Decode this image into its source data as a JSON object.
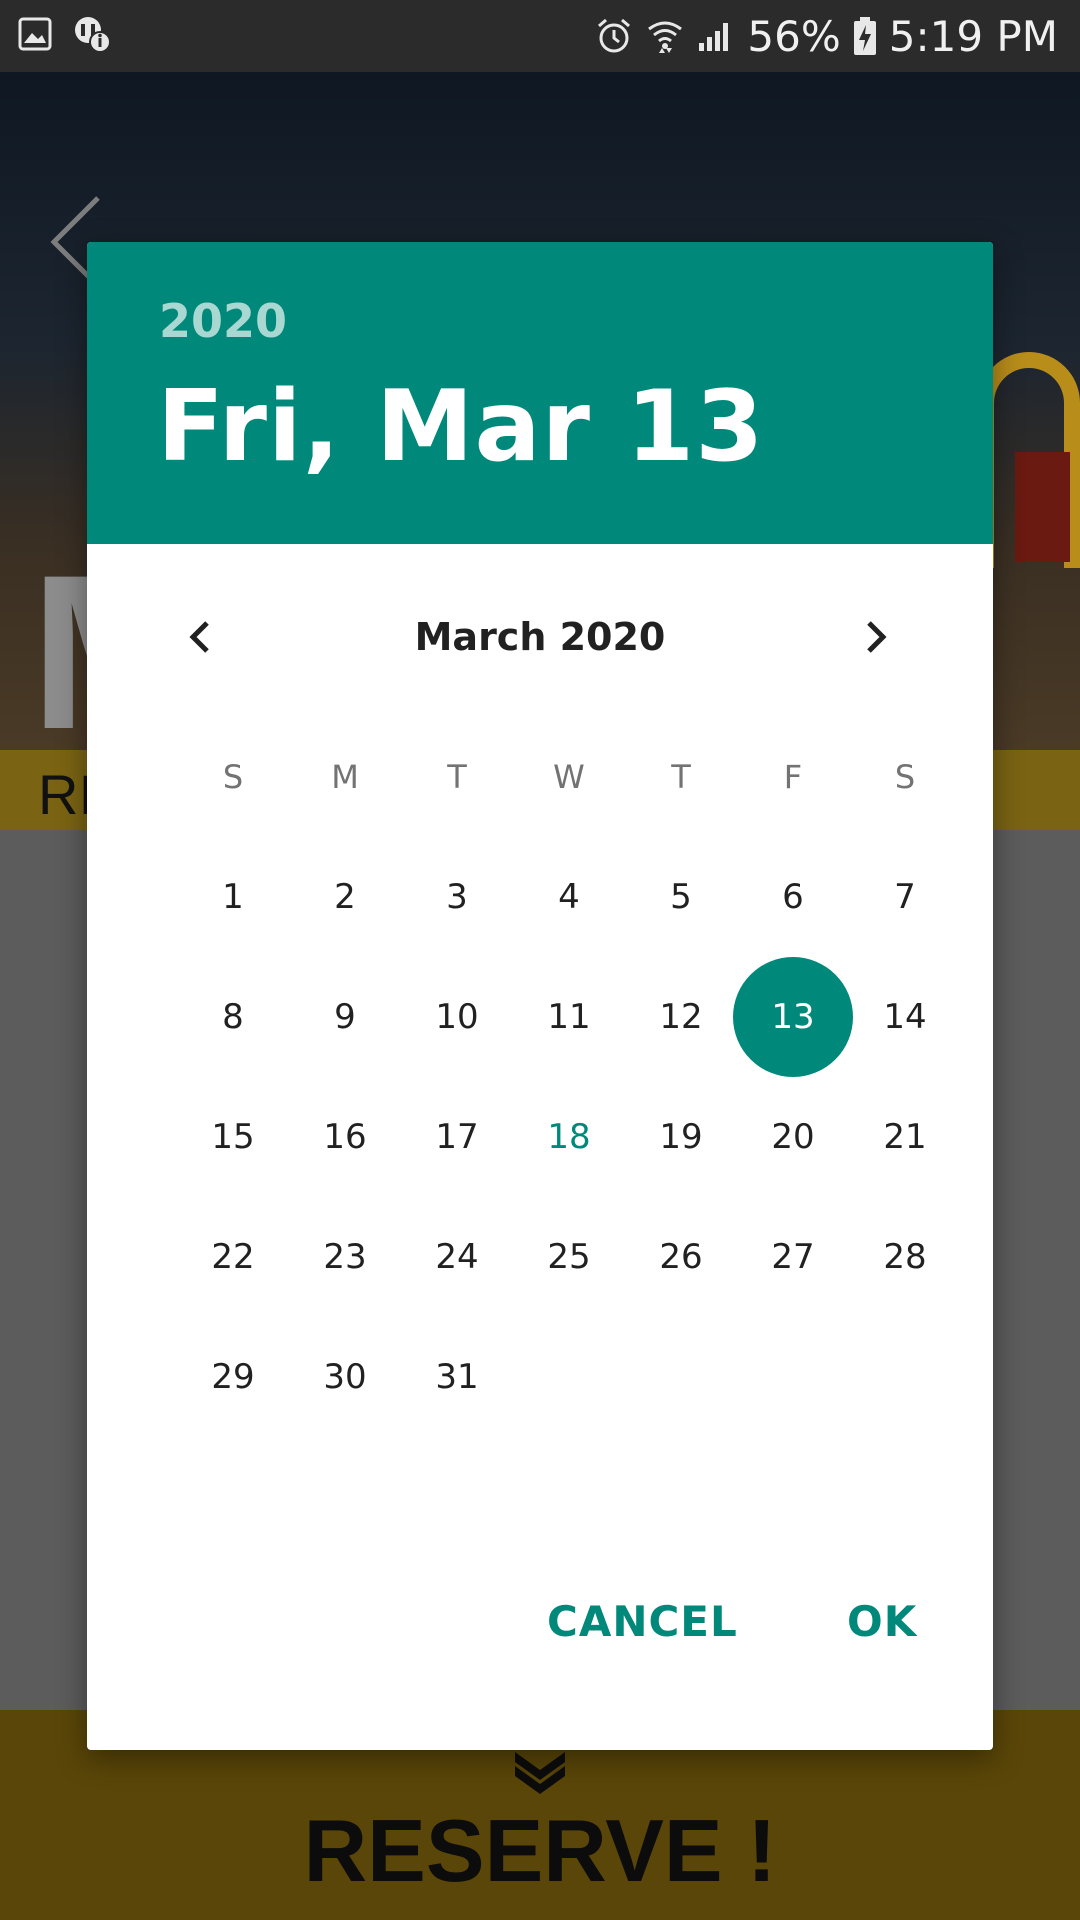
{
  "status_bar": {
    "battery": "56%",
    "time": "5:19 PM",
    "icons": [
      "image-icon",
      "blocked-info-icon",
      "alarm-icon",
      "wifi-icon",
      "signal-icon",
      "battery-charging-icon"
    ]
  },
  "background": {
    "band_text": "RI",
    "reserve_label": "RESERVE !",
    "back_icon": "chevron-left-icon"
  },
  "dialog": {
    "year": "2020",
    "selected_date": "Fri, Mar 13",
    "month_label": "March 2020",
    "weekdays": [
      "S",
      "M",
      "T",
      "W",
      "T",
      "F",
      "S"
    ],
    "first_weekday_offset": 0,
    "days": [
      "1",
      "2",
      "3",
      "4",
      "5",
      "6",
      "7",
      "8",
      "9",
      "10",
      "11",
      "12",
      "13",
      "14",
      "15",
      "16",
      "17",
      "18",
      "19",
      "20",
      "21",
      "22",
      "23",
      "24",
      "25",
      "26",
      "27",
      "28",
      "29",
      "30",
      "31"
    ],
    "selected_day": "13",
    "today_day": "18",
    "cancel_label": "CANCEL",
    "ok_label": "OK"
  },
  "colors": {
    "accent": "#00897b",
    "header_year": "#a8d8d1"
  }
}
